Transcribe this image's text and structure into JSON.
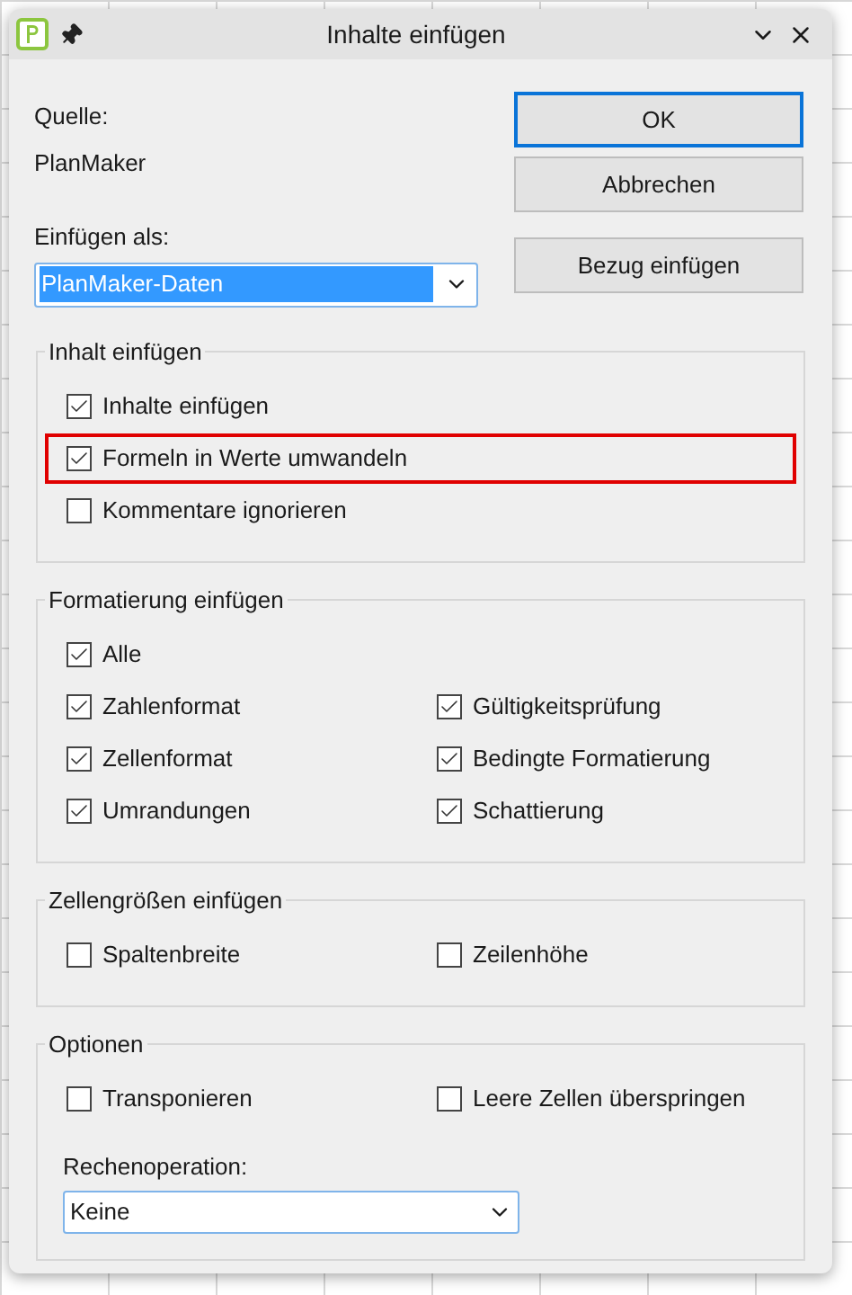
{
  "window": {
    "title": "Inhalte einfügen"
  },
  "source": {
    "label": "Quelle:",
    "value": "PlanMaker"
  },
  "paste_as": {
    "label": "Einfügen als:",
    "value": "PlanMaker-Daten"
  },
  "buttons": [
    {
      "label": "OK",
      "default": true
    },
    {
      "label": "Abbrechen",
      "default": false
    },
    {
      "label": "Bezug einfügen",
      "default": false
    }
  ],
  "groups": [
    {
      "title": "Inhalt einfügen",
      "kind": "single",
      "items": [
        {
          "label": "Inhalte einfügen",
          "checked": true,
          "highlighted": false
        },
        {
          "label": "Formeln in Werte umwandeln",
          "checked": true,
          "highlighted": true
        },
        {
          "label": "Kommentare ignorieren",
          "checked": false,
          "highlighted": false
        }
      ]
    },
    {
      "title": "Formatierung einfügen",
      "kind": "mixed",
      "items": [
        {
          "label": "Alle",
          "checked": true,
          "highlighted": false
        },
        {
          "label": "Zahlenformat",
          "checked": true,
          "highlighted": false
        },
        {
          "label": "Gültigkeitsprüfung",
          "checked": true,
          "highlighted": false
        },
        {
          "label": "Zellenformat",
          "checked": true,
          "highlighted": false
        },
        {
          "label": "Bedingte Formatierung",
          "checked": true,
          "highlighted": false
        },
        {
          "label": "Umrandungen",
          "checked": true,
          "highlighted": false
        },
        {
          "label": "Schattierung",
          "checked": true,
          "highlighted": false
        }
      ]
    },
    {
      "title": "Zellengrößen einfügen",
      "kind": "pair",
      "items": [
        {
          "label": "Spaltenbreite",
          "checked": false,
          "highlighted": false
        },
        {
          "label": "Zeilenhöhe",
          "checked": false,
          "highlighted": false
        }
      ]
    },
    {
      "title": "Optionen",
      "kind": "pair",
      "items": [
        {
          "label": "Transponieren",
          "checked": false,
          "highlighted": false
        },
        {
          "label": "Leere Zellen überspringen",
          "checked": false,
          "highlighted": false
        }
      ],
      "select": {
        "label": "Rechenoperation:",
        "value": "Keine"
      }
    }
  ]
}
